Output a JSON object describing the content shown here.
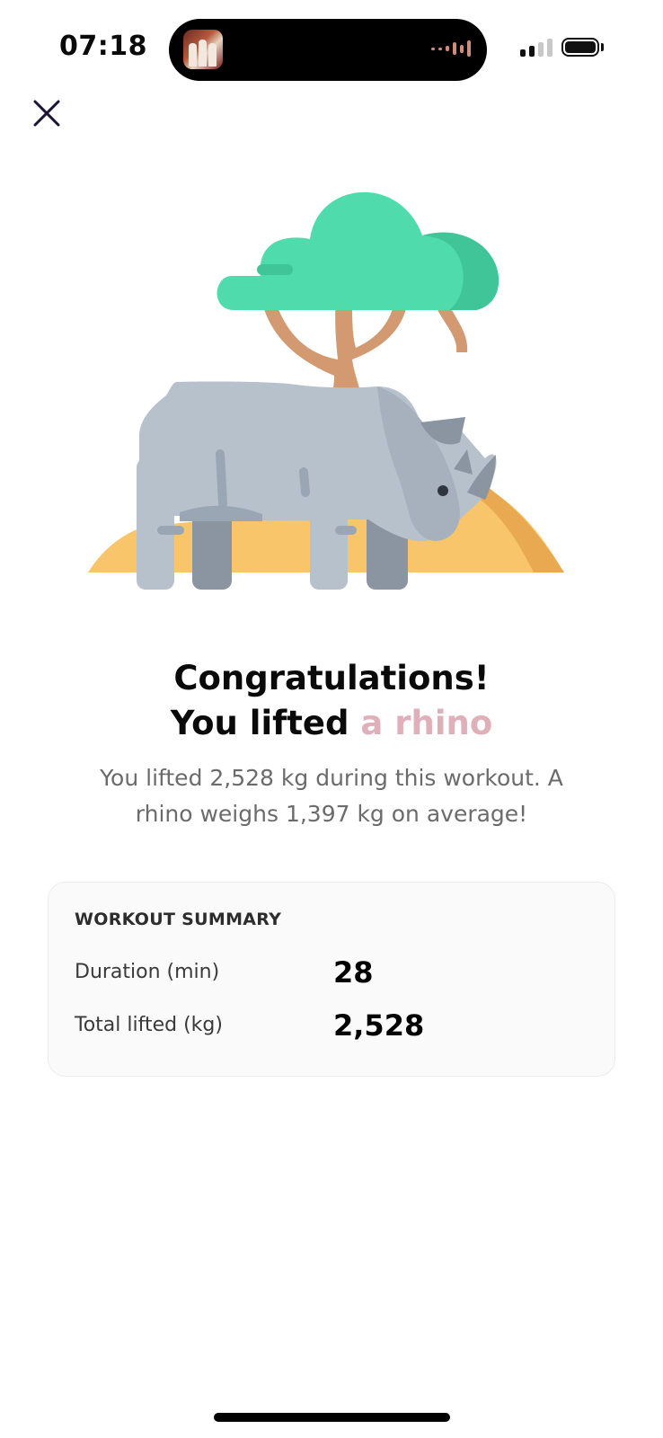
{
  "status_bar": {
    "time": "07:18"
  },
  "icons": {
    "close": "close-icon",
    "illustration": "rhino-under-tree-illustration"
  },
  "congrats": {
    "title": "Congratulations!",
    "subtitle_prefix": "You lifted",
    "subtitle_highlight": "a rhino",
    "description": "You lifted 2,528 kg during this workout. A rhino weighs 1,397 kg on average!"
  },
  "summary": {
    "heading": "WORKOUT SUMMARY",
    "rows": [
      {
        "label": "Duration (min)",
        "value": "28"
      },
      {
        "label": "Total lifted (kg)",
        "value": "2,528"
      }
    ]
  },
  "colors": {
    "accent": "#e0b0ba",
    "tree": "#4fdbab",
    "sand": "#f9c56a",
    "rhino": "#b6c1cc"
  }
}
